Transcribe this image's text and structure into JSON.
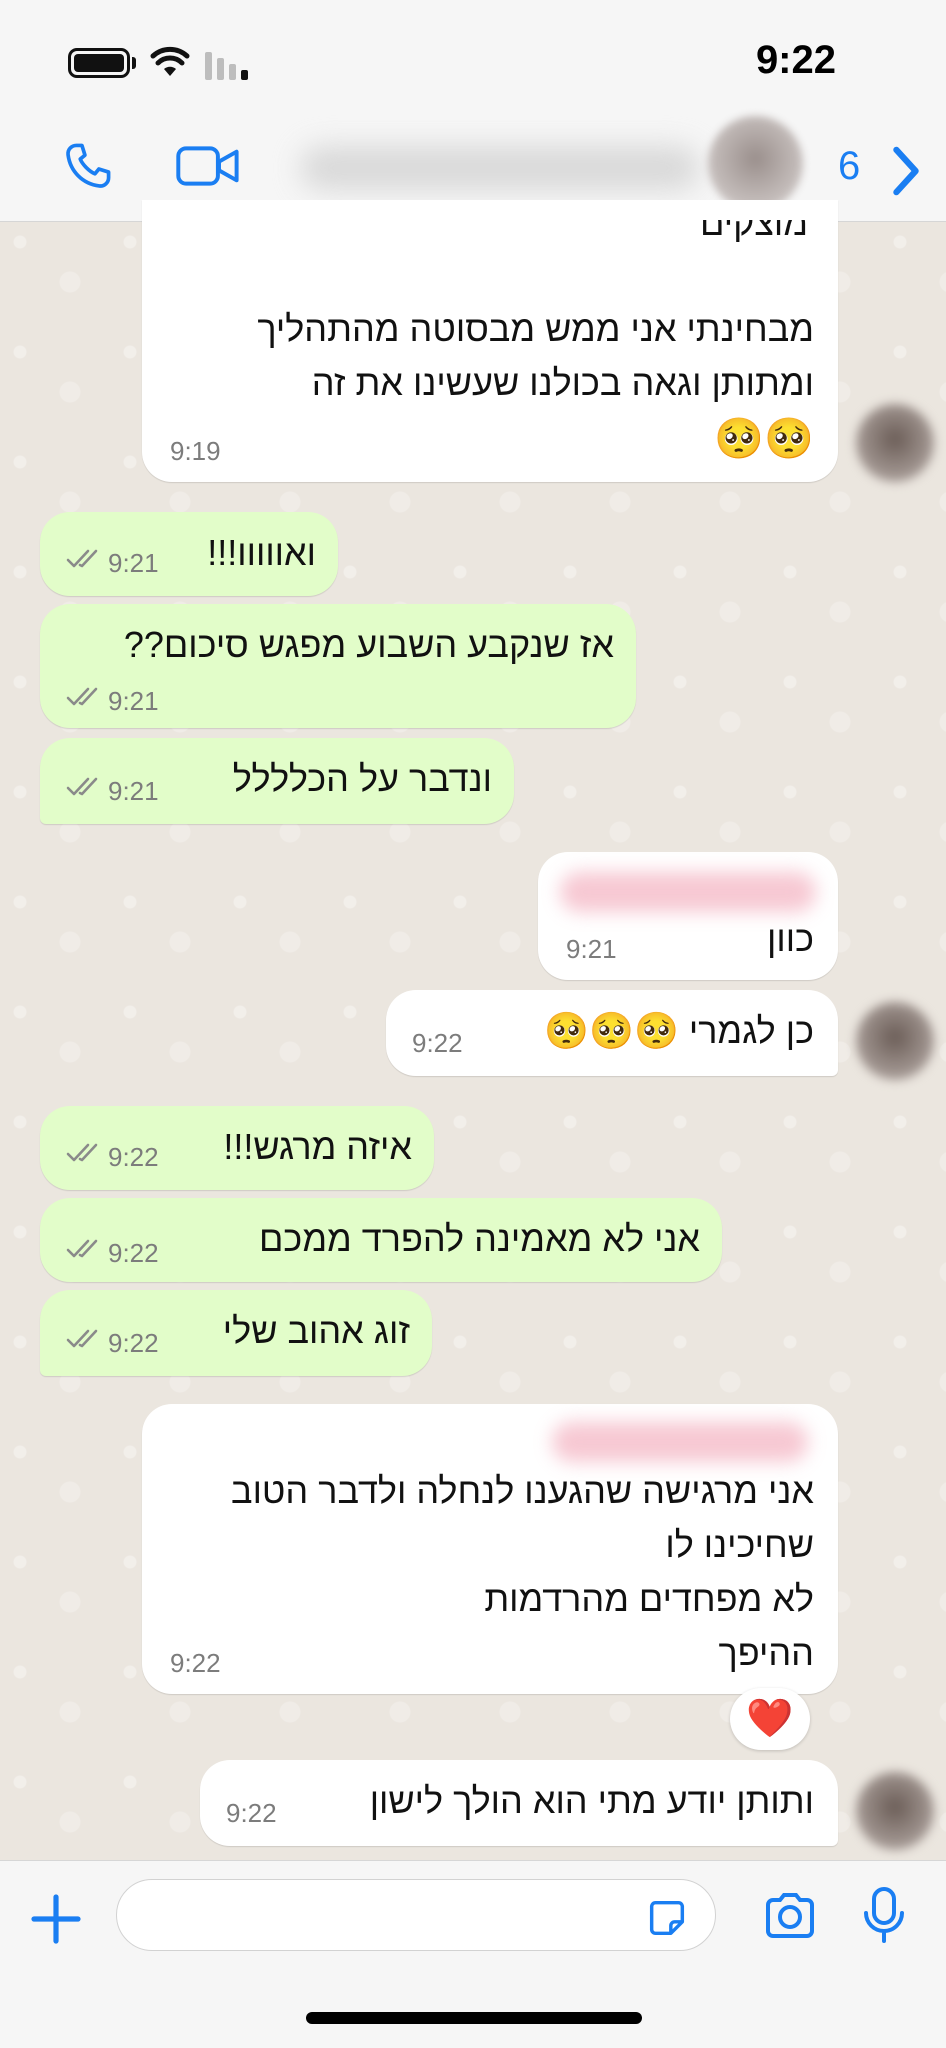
{
  "status_bar": {
    "time": "9:22"
  },
  "header": {
    "unread_count": "6",
    "icons": [
      "call-icon",
      "video-icon",
      "back-chevron-icon"
    ]
  },
  "messages": [
    {
      "id": "m1",
      "direction": "incoming",
      "lines": [
        "מוצקים",
        "",
        "מבחינתי אני ממש מבסוטה מהתהליך",
        "ומתותן וגאה בכולנו שעשינו את זה",
        "🥺🥺"
      ],
      "time": "9:19"
    },
    {
      "id": "m2",
      "direction": "outgoing",
      "lines": [
        "ואווווו!!!"
      ],
      "time": "9:21",
      "status": "read"
    },
    {
      "id": "m3",
      "direction": "outgoing",
      "lines": [
        "אז שנקבע השבוע מפגש סיכום??"
      ],
      "time": "9:21",
      "status": "read"
    },
    {
      "id": "m4",
      "direction": "outgoing",
      "lines": [
        "ונדבר על הכלללל"
      ],
      "time": "9:21",
      "status": "read"
    },
    {
      "id": "m5",
      "direction": "incoming",
      "lines": [
        "כוון"
      ],
      "time": "9:21"
    },
    {
      "id": "m6",
      "direction": "incoming",
      "lines": [
        "כן לגמרי 🥺🥺🥺"
      ],
      "time": "9:22"
    },
    {
      "id": "m7",
      "direction": "outgoing",
      "lines": [
        "איזה מרגש!!!"
      ],
      "time": "9:22",
      "status": "read"
    },
    {
      "id": "m8",
      "direction": "outgoing",
      "lines": [
        "אני לא מאמינה להפרד ממכם"
      ],
      "time": "9:22",
      "status": "read"
    },
    {
      "id": "m9",
      "direction": "outgoing",
      "lines": [
        "זוג אהוב שלי"
      ],
      "time": "9:22",
      "status": "read"
    },
    {
      "id": "m10",
      "direction": "incoming",
      "lines": [
        "אני מרגישה שהגענו לנחלה ולדבר הטוב",
        "שחיכינו לו",
        "לא מפחדים מהרדמות",
        "ההיפך"
      ],
      "time": "9:22",
      "reaction": "❤️"
    },
    {
      "id": "m11",
      "direction": "incoming",
      "lines": [
        "ותותן יודע מתי הוא הולך לישון"
      ],
      "time": "9:22"
    }
  ],
  "composer": {
    "placeholder": ""
  },
  "colors": {
    "accent": "#1a7ef2",
    "outgoing_bubble": "#e2fdc9",
    "incoming_bubble": "#ffffff",
    "read_ticks": "#8a8a8a"
  }
}
